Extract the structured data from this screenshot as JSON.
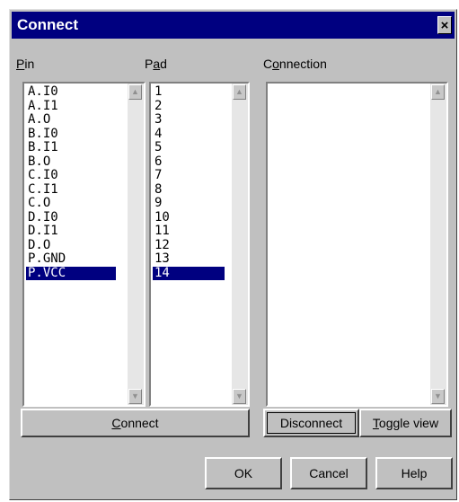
{
  "window": {
    "title": "Connect",
    "close_glyph": "×"
  },
  "labels": {
    "pin": {
      "key": "P",
      "rest": "in"
    },
    "pad": {
      "pre": "P",
      "key": "a",
      "rest": "d"
    },
    "connection": {
      "pre": "C",
      "key": "o",
      "rest": "nnection"
    }
  },
  "pin_list": {
    "items": [
      "A.I0",
      "A.I1",
      "A.O",
      "B.I0",
      "B.I1",
      "B.O",
      "C.I0",
      "C.I1",
      "C.O",
      "D.I0",
      "D.I1",
      "D.O",
      "P.GND",
      "P.VCC"
    ],
    "selected": "P.VCC"
  },
  "pad_list": {
    "items": [
      "1",
      "2",
      "3",
      "4",
      "5",
      "6",
      "7",
      "8",
      "9",
      "10",
      "11",
      "12",
      "13",
      "14"
    ],
    "selected": "14"
  },
  "connection_list": {
    "items": []
  },
  "buttons": {
    "connect": {
      "key": "C",
      "rest": "onnect"
    },
    "disconnect": "Disconnect",
    "toggle_view": {
      "key": "T",
      "rest": "oggle view"
    },
    "ok": "OK",
    "cancel": "Cancel",
    "help": "Help"
  },
  "icons": {
    "scroll_up": "arrow-up-icon",
    "scroll_down": "arrow-down-icon"
  },
  "colors": {
    "title_bar": "#000080",
    "selection": "#000080",
    "face": "#c0c0c0"
  }
}
